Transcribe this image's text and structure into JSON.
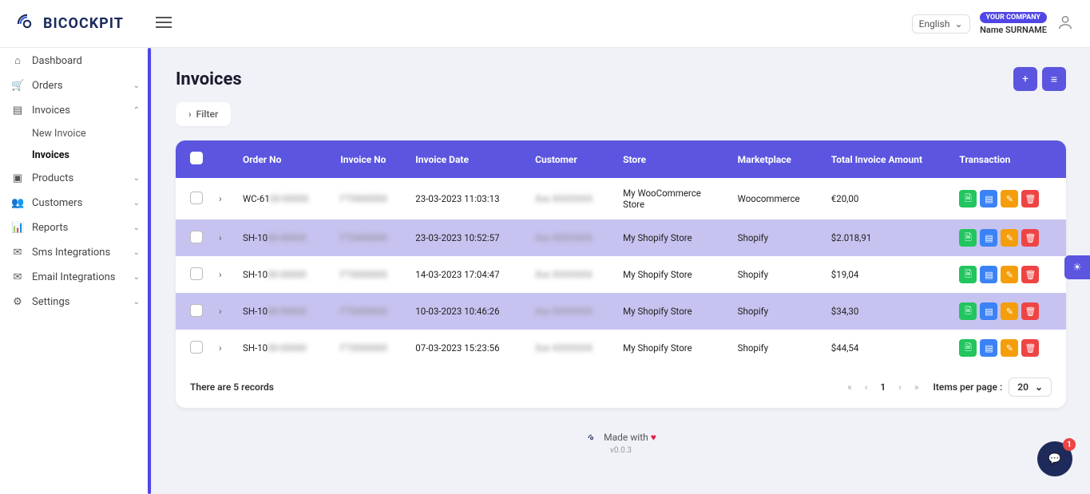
{
  "brand": "BICOCKPIT",
  "language": "English",
  "user": {
    "company": "YOUR COMPANY",
    "name": "Name SURNAME"
  },
  "sidebar": {
    "items": [
      {
        "label": "Dashboard",
        "icon": "home-icon",
        "expand": null
      },
      {
        "label": "Orders",
        "icon": "cart-icon",
        "expand": "down"
      },
      {
        "label": "Invoices",
        "icon": "doc-icon",
        "expand": "up",
        "subs": [
          {
            "label": "New Invoice",
            "active": false
          },
          {
            "label": "Invoices",
            "active": true
          }
        ]
      },
      {
        "label": "Products",
        "icon": "box-icon",
        "expand": "down"
      },
      {
        "label": "Customers",
        "icon": "users-icon",
        "expand": "down"
      },
      {
        "label": "Reports",
        "icon": "chart-icon",
        "expand": "down"
      },
      {
        "label": "Sms Integrations",
        "icon": "sms-icon",
        "expand": "down"
      },
      {
        "label": "Email Integrations",
        "icon": "mail-icon",
        "expand": "down"
      },
      {
        "label": "Settings",
        "icon": "gear-icon",
        "expand": "down"
      }
    ]
  },
  "page": {
    "title": "Invoices",
    "filter_label": "Filter"
  },
  "table": {
    "headers": [
      "Order No",
      "Invoice No",
      "Invoice Date",
      "Customer",
      "Store",
      "Marketplace",
      "Total Invoice Amount",
      "Transaction"
    ],
    "rows": [
      {
        "order": "WC-61",
        "invoice": "",
        "date": "23-03-2023 11:03:13",
        "customer": "",
        "store": "My WooCommerce Store",
        "marketplace": "Woocommerce",
        "amount": "€20,00"
      },
      {
        "order": "SH-10",
        "invoice": "",
        "date": "23-03-2023 10:52:57",
        "customer": "",
        "store": "My Shopify Store",
        "marketplace": "Shopify",
        "amount": "$2.018,91"
      },
      {
        "order": "SH-10",
        "invoice": "",
        "date": "14-03-2023 17:04:47",
        "customer": "",
        "store": "My Shopify Store",
        "marketplace": "Shopify",
        "amount": "$19,04"
      },
      {
        "order": "SH-10",
        "invoice": "",
        "date": "10-03-2023 10:46:26",
        "customer": "",
        "store": "My Shopify Store",
        "marketplace": "Shopify",
        "amount": "$34,30"
      },
      {
        "order": "SH-10",
        "invoice": "",
        "date": "07-03-2023 15:23:56",
        "customer": "",
        "store": "My Shopify Store",
        "marketplace": "Shopify",
        "amount": "$44,54"
      }
    ],
    "record_count_text": "There are 5 records",
    "current_page": "1",
    "items_per_page_label": "Items per page :",
    "items_per_page": "20"
  },
  "footer": {
    "text": "Made with",
    "version": "v0.0.3"
  },
  "chat_badge": "1"
}
